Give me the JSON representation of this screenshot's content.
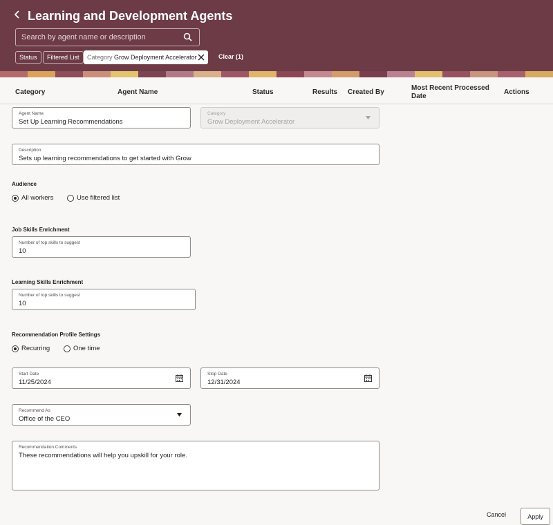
{
  "header": {
    "title": "Learning and Development Agents",
    "search_placeholder": "Search by agent name or description",
    "filters": {
      "status_label": "Status",
      "filtered_list_label": "Filtered List",
      "category_key": "Category",
      "category_value": "Grow Deployment Accelerator",
      "clear_label": "Clear (1)"
    },
    "background_color": "#6d3b46"
  },
  "table": {
    "columns": [
      "Category",
      "Agent Name",
      "Status",
      "Results",
      "Created By",
      "Most Recent Processed",
      "Date",
      "Actions"
    ]
  },
  "form": {
    "agent_name": {
      "label": "Agent Name",
      "value": "Set Up Learning Recommendations"
    },
    "category": {
      "label": "Category",
      "value": "Grow Deployment Accelerator"
    },
    "description": {
      "label": "Description",
      "value": "Sets up learning recommendations to get started with Grow"
    },
    "audience": {
      "label": "Audience",
      "options": [
        "All workers",
        "Use filtered list"
      ],
      "selected": "All workers"
    },
    "job_skills": {
      "label": "Job Skills Enrichment",
      "field_label": "Number of top skills to suggest",
      "value": "10"
    },
    "learning_skills": {
      "label": "Learning Skills Enrichment",
      "field_label": "Number of top skills to suggest",
      "value": "10"
    },
    "profile_settings": {
      "label": "Recommendation Profile Settings",
      "options": [
        "Recurring",
        "One time"
      ],
      "selected": "Recurring"
    },
    "start_date": {
      "label": "Start Date",
      "value": "11/25/2024"
    },
    "stop_date": {
      "label": "Stop Date",
      "value": "12/31/2024"
    },
    "recommend_as": {
      "label": "Recommend As",
      "value": "Office of the CEO"
    },
    "comments": {
      "label": "Recommendation Comments",
      "value": "These recommendations will help you upskill for your role."
    }
  },
  "footer": {
    "cancel_label": "Cancel",
    "apply_label": "Apply"
  }
}
